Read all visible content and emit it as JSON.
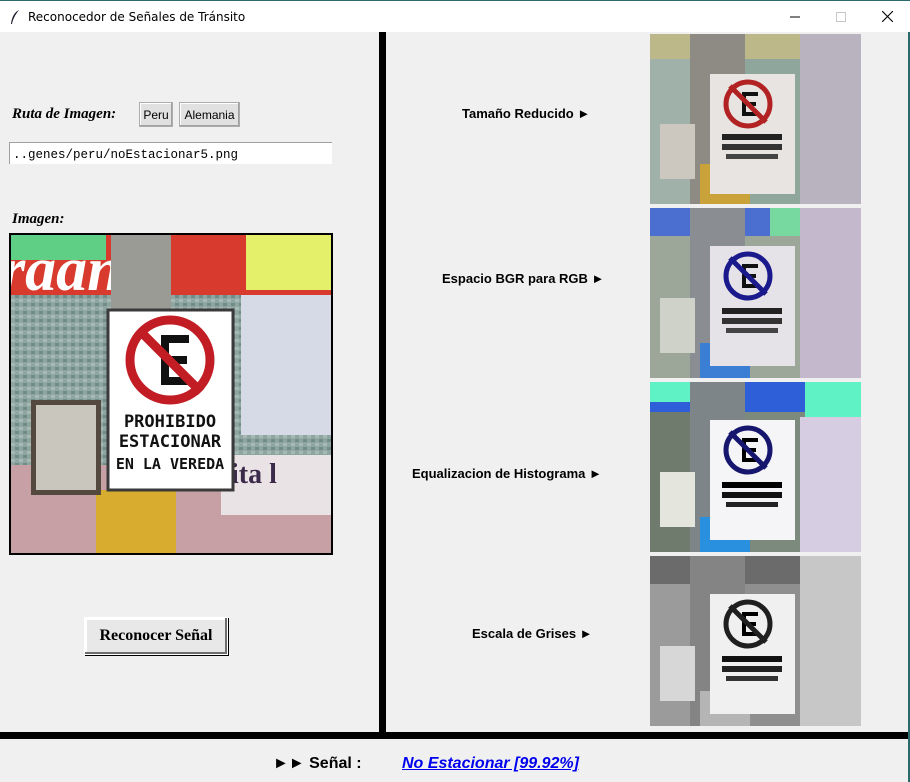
{
  "window": {
    "title": "Reconocedor de Señales de Tránsito"
  },
  "left_panel": {
    "ruta_label": "Ruta de Imagen:",
    "buttons": {
      "peru": "Peru",
      "alemania": "Alemania"
    },
    "path_value": "..genes/peru/noEstacionar5.png",
    "imagen_label": "Imagen:",
    "sign_text": [
      "PROHIBIDO",
      "ESTACIONAR",
      "EN LA VEREDA"
    ],
    "recognize_button": "Reconocer Señal"
  },
  "steps": [
    {
      "label": "Tamaño Reducido ►",
      "tone": "color"
    },
    {
      "label": "Espacio BGR para RGB ►",
      "tone": "rgb"
    },
    {
      "label": "Equalizacion de Histograma ►",
      "tone": "equalized"
    },
    {
      "label": "Escala de Grises ►",
      "tone": "gray"
    }
  ],
  "result": {
    "prefix": "►► Señal :",
    "value": " No Estacionar [99.92%]"
  },
  "colors": {
    "sign_red": "#c21d24",
    "sign_blue": "#1a1a8c",
    "accent_link": "#0000ee",
    "window_border": "#2b6b6b"
  }
}
